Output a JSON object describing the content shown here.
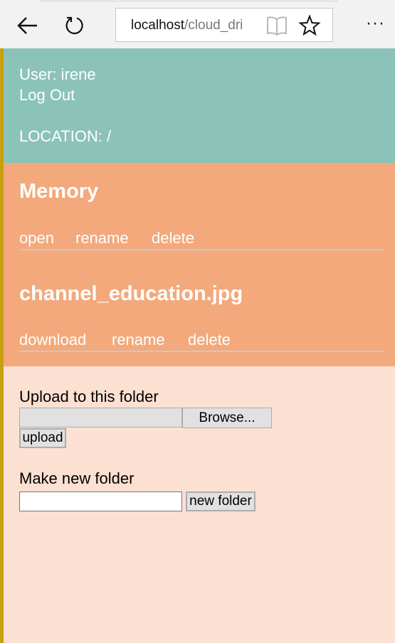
{
  "browser": {
    "url_host": "localhost",
    "url_path": "/cloud_dri",
    "more_label": "···"
  },
  "header": {
    "user_label": "User: irene",
    "logout_label": "Log Out",
    "location_label": "LOCATION: /"
  },
  "items": [
    {
      "name": "Memory",
      "actions": [
        "open",
        "rename",
        "delete"
      ]
    },
    {
      "name": "channel_education.jpg",
      "actions": [
        "download",
        "rename",
        "delete"
      ]
    }
  ],
  "upload": {
    "label": "Upload to this folder",
    "browse_label": "Browse...",
    "upload_button": "upload"
  },
  "new_folder": {
    "label": "Make new folder",
    "input_value": "",
    "button_label": "new folder"
  },
  "colors": {
    "header_bg": "#8bc3b8",
    "items_bg": "#f3a97c",
    "forms_bg": "#fce0d2"
  }
}
